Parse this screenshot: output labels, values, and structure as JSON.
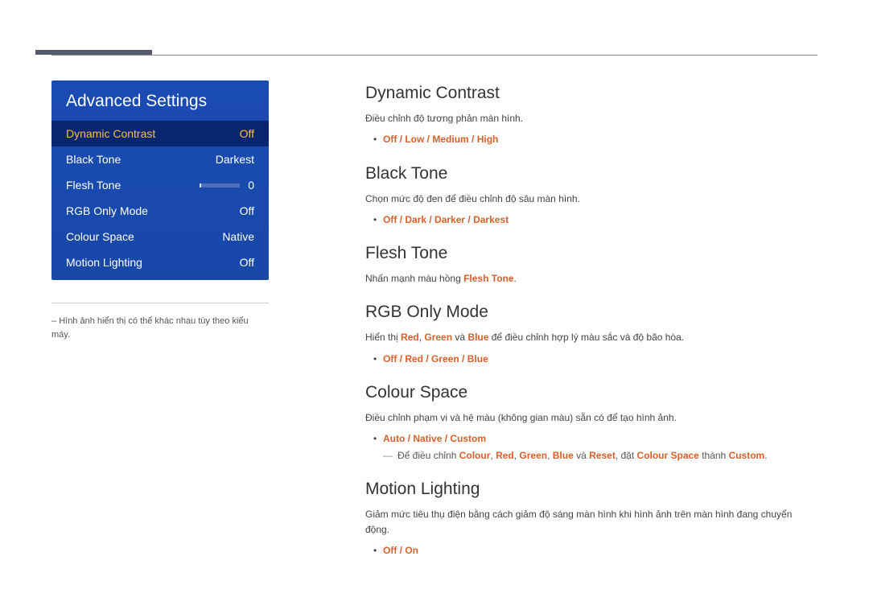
{
  "menu": {
    "title": "Advanced Settings",
    "items": [
      {
        "label": "Dynamic Contrast",
        "value": "Off",
        "selected": true
      },
      {
        "label": "Black Tone",
        "value": "Darkest"
      },
      {
        "label": "Flesh Tone",
        "value": "0",
        "slider": true
      },
      {
        "label": "RGB Only Mode",
        "value": "Off"
      },
      {
        "label": "Colour Space",
        "value": "Native"
      },
      {
        "label": "Motion Lighting",
        "value": "Off"
      }
    ]
  },
  "sidebar_note": "Hình ảnh hiển thị có thể khác nhau tùy theo kiểu máy.",
  "sections": {
    "dynamic_contrast": {
      "title": "Dynamic Contrast",
      "desc": "Điều chỉnh độ tương phản màn hình.",
      "options": [
        "Off",
        "Low",
        "Medium",
        "High"
      ]
    },
    "black_tone": {
      "title": "Black Tone",
      "desc": "Chọn mức độ đen để điều chỉnh độ sâu màn hình.",
      "options": [
        "Off",
        "Dark",
        "Darker",
        "Darkest"
      ]
    },
    "flesh_tone": {
      "title": "Flesh Tone",
      "desc_pre": "Nhấn mạnh màu hồng ",
      "desc_accent": "Flesh Tone",
      "desc_post": "."
    },
    "rgb_only": {
      "title": "RGB Only Mode",
      "desc_pre": "Hiển thị ",
      "r": "Red",
      "g": "Green",
      "b": "Blue",
      "sep1": ", ",
      "and": " và ",
      "desc_post": " để điều chỉnh hợp lý màu sắc và độ bão hòa.",
      "options": [
        "Off",
        "Red",
        "Green",
        "Blue"
      ]
    },
    "colour_space": {
      "title": "Colour Space",
      "desc": "Điều chỉnh phạm vi và hệ màu (không gian màu) sẵn có để tạo hình ảnh.",
      "options": [
        "Auto",
        "Native",
        "Custom"
      ],
      "note_pre": "Để điều chỉnh ",
      "note_words": {
        "colour": "Colour",
        "red": "Red",
        "green": "Green",
        "blue": "Blue",
        "reset": "Reset",
        "colour_space": "Colour Space",
        "custom": "Custom"
      },
      "note_mid1": ", đặt ",
      "note_mid2": " thành ",
      "note_and": " và ",
      "comma": ", ",
      "period": "."
    },
    "motion_lighting": {
      "title": "Motion Lighting",
      "desc": "Giảm mức tiêu thụ điện bằng cách giảm độ sáng màn hình khi hình ảnh trên màn hình đang chuyển động.",
      "options": [
        "Off",
        "On"
      ]
    }
  },
  "slash": " / "
}
